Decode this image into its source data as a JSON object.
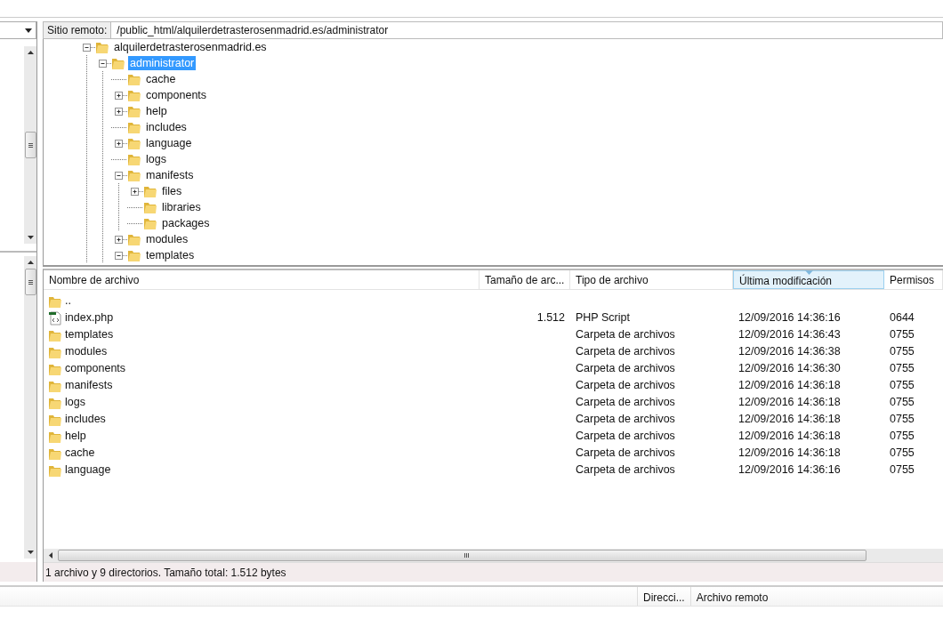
{
  "remote_site": {
    "label": "Sitio remoto:",
    "path": "/public_html/alquilerdetrasterosenmadrid.es/administrator"
  },
  "tree": [
    {
      "kind": "branch",
      "name": "alquilerdetrasterosenmadrid.es",
      "expanded": true,
      "selected": false,
      "children": [
        {
          "kind": "branch",
          "name": "administrator",
          "expanded": true,
          "selected": true,
          "children": [
            {
              "kind": "leaf",
              "name": "cache",
              "expanded": false,
              "selected": false
            },
            {
              "kind": "branch",
              "name": "components",
              "expanded": false,
              "selected": false
            },
            {
              "kind": "branch",
              "name": "help",
              "expanded": false,
              "selected": false
            },
            {
              "kind": "leaf",
              "name": "includes",
              "expanded": false,
              "selected": false
            },
            {
              "kind": "branch",
              "name": "language",
              "expanded": false,
              "selected": false
            },
            {
              "kind": "leaf",
              "name": "logs",
              "expanded": false,
              "selected": false
            },
            {
              "kind": "branch",
              "name": "manifests",
              "expanded": true,
              "selected": false,
              "children": [
                {
                  "kind": "branch",
                  "name": "files",
                  "expanded": false,
                  "selected": false
                },
                {
                  "kind": "leaf",
                  "name": "libraries",
                  "expanded": false,
                  "selected": false
                },
                {
                  "kind": "leaf",
                  "name": "packages",
                  "expanded": false,
                  "selected": false
                }
              ]
            },
            {
              "kind": "branch",
              "name": "modules",
              "expanded": false,
              "selected": false
            },
            {
              "kind": "branch",
              "name": "templates",
              "expanded": true,
              "selected": false
            }
          ]
        }
      ]
    }
  ],
  "file_list": {
    "columns": [
      {
        "label": "Nombre de archivo",
        "sorted": false
      },
      {
        "label": "Tamaño de arc...",
        "sorted": false
      },
      {
        "label": "Tipo de archivo",
        "sorted": false
      },
      {
        "label": "Última modificación",
        "sorted": true
      },
      {
        "label": "Permisos",
        "sorted": false
      }
    ],
    "rows": [
      {
        "kind": "folder",
        "name": ".."
      },
      {
        "kind": "file",
        "name": "index.php",
        "size": "1.512",
        "type": "PHP Script",
        "modified": "12/09/2016 14:36:16",
        "permissions": "0644"
      },
      {
        "kind": "folder",
        "name": "templates",
        "type": "Carpeta de archivos",
        "modified": "12/09/2016 14:36:43",
        "permissions": "0755"
      },
      {
        "kind": "folder",
        "name": "modules",
        "type": "Carpeta de archivos",
        "modified": "12/09/2016 14:36:38",
        "permissions": "0755"
      },
      {
        "kind": "folder",
        "name": "components",
        "type": "Carpeta de archivos",
        "modified": "12/09/2016 14:36:30",
        "permissions": "0755"
      },
      {
        "kind": "folder",
        "name": "manifests",
        "type": "Carpeta de archivos",
        "modified": "12/09/2016 14:36:18",
        "permissions": "0755"
      },
      {
        "kind": "folder",
        "name": "logs",
        "type": "Carpeta de archivos",
        "modified": "12/09/2016 14:36:18",
        "permissions": "0755"
      },
      {
        "kind": "folder",
        "name": "includes",
        "type": "Carpeta de archivos",
        "modified": "12/09/2016 14:36:18",
        "permissions": "0755"
      },
      {
        "kind": "folder",
        "name": "help",
        "type": "Carpeta de archivos",
        "modified": "12/09/2016 14:36:18",
        "permissions": "0755"
      },
      {
        "kind": "folder",
        "name": "cache",
        "type": "Carpeta de archivos",
        "modified": "12/09/2016 14:36:18",
        "permissions": "0755"
      },
      {
        "kind": "folder",
        "name": "language",
        "type": "Carpeta de archivos",
        "modified": "12/09/2016 14:36:16",
        "permissions": "0755"
      }
    ]
  },
  "status_bar": "1 archivo y 9 directorios. Tamaño total: 1.512 bytes",
  "queue": {
    "columns": [
      "Direcci...",
      "Archivo remoto"
    ]
  }
}
